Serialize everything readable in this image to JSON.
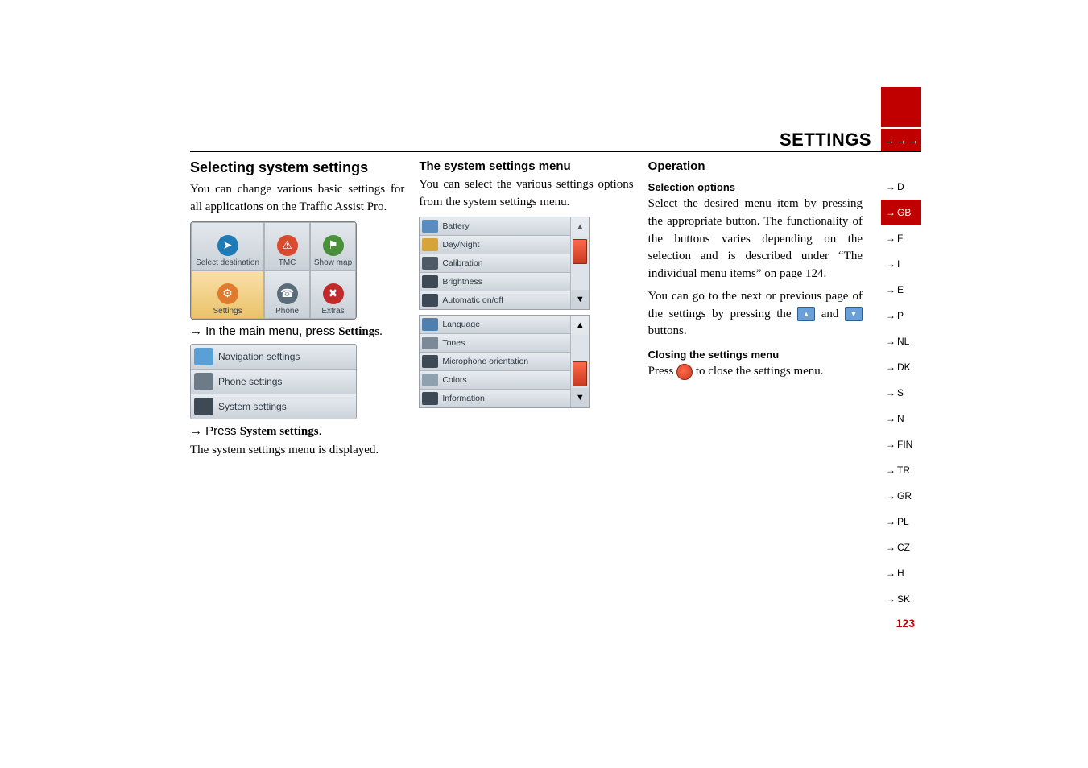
{
  "section": {
    "title": "SETTINGS",
    "arrows": "→→→"
  },
  "languages": [
    {
      "code": "D",
      "active": false
    },
    {
      "code": "GB",
      "active": true
    },
    {
      "code": "F",
      "active": false
    },
    {
      "code": "I",
      "active": false
    },
    {
      "code": "E",
      "active": false
    },
    {
      "code": "P",
      "active": false
    },
    {
      "code": "NL",
      "active": false
    },
    {
      "code": "DK",
      "active": false
    },
    {
      "code": "S",
      "active": false
    },
    {
      "code": "N",
      "active": false
    },
    {
      "code": "FIN",
      "active": false
    },
    {
      "code": "TR",
      "active": false
    },
    {
      "code": "GR",
      "active": false
    },
    {
      "code": "PL",
      "active": false
    },
    {
      "code": "CZ",
      "active": false
    },
    {
      "code": "H",
      "active": false
    },
    {
      "code": "SK",
      "active": false
    }
  ],
  "col1": {
    "heading": "Selecting system settings",
    "intro": "You can change various basic settings for all applications on the Traffic Assist Pro.",
    "step1_pre": "→ In the main menu, press ",
    "step1_bold": "Settings",
    "step1_post": ".",
    "step2_pre": "→ Press ",
    "step2_bold": "System settings",
    "step2_post": ".",
    "result": "The system settings menu is displayed."
  },
  "main_menu": {
    "cells": [
      {
        "label": "Select destination",
        "icon": "➤",
        "color": "#1f7bb6"
      },
      {
        "label": "TMC",
        "icon": "⚠",
        "color": "#d94b2e"
      },
      {
        "label": "Show map",
        "icon": "⚑",
        "color": "#4a8f3a"
      },
      {
        "label": "Settings",
        "icon": "⚙",
        "color": "#e07b2e",
        "active": true
      },
      {
        "label": "Phone",
        "icon": "☎",
        "color": "#5a6b7a"
      },
      {
        "label": "Extras",
        "icon": "✖",
        "color": "#c02a2a"
      }
    ]
  },
  "settings_menu": {
    "rows": [
      {
        "label": "Navigation settings",
        "color": "#5aa0d4"
      },
      {
        "label": "Phone settings",
        "color": "#6d7b88"
      },
      {
        "label": "System settings",
        "color": "#3d4a55"
      }
    ]
  },
  "col2": {
    "heading": "The system settings menu",
    "intro": "You can select the various settings options from the system settings menu."
  },
  "sys_menu_p1": {
    "rows": [
      {
        "label": "Battery",
        "color": "#5a8cc0"
      },
      {
        "label": "Day/Night",
        "color": "#d7a43a"
      },
      {
        "label": "Calibration",
        "color": "#4e5b67"
      },
      {
        "label": "Brightness",
        "color": "#3d4a55"
      },
      {
        "label": "Automatic on/off",
        "color": "#3d4a55"
      }
    ],
    "thumb_top": "6%",
    "thumb_h": "44%",
    "up_dark": false,
    "down_dark": true
  },
  "sys_menu_p2": {
    "rows": [
      {
        "label": "Language",
        "color": "#4f7faf"
      },
      {
        "label": "Tones",
        "color": "#7c8a97"
      },
      {
        "label": "Microphone orientation",
        "color": "#3d4a55"
      },
      {
        "label": "Colors",
        "color": "#8fa0af"
      },
      {
        "label": "Information",
        "color": "#3d4a55"
      }
    ],
    "thumb_top": "50%",
    "thumb_h": "44%",
    "up_dark": true,
    "down_dark": true
  },
  "col3": {
    "heading": "Operation",
    "sub1": "Selection options",
    "p1a": "Select the desired menu item by pressing the appropriate button. The functionality of the buttons varies depending on the selection and is described under “The individual menu items” on page 124.",
    "p1b_pre": "You can go to the next or previous page of the settings by pressing the ",
    "p1b_mid": " and ",
    "p1b_post": " buttons.",
    "sub2": "Closing the settings menu",
    "p2_pre": "Press ",
    "p2_post": " to close the settings menu."
  },
  "page_number": "123"
}
